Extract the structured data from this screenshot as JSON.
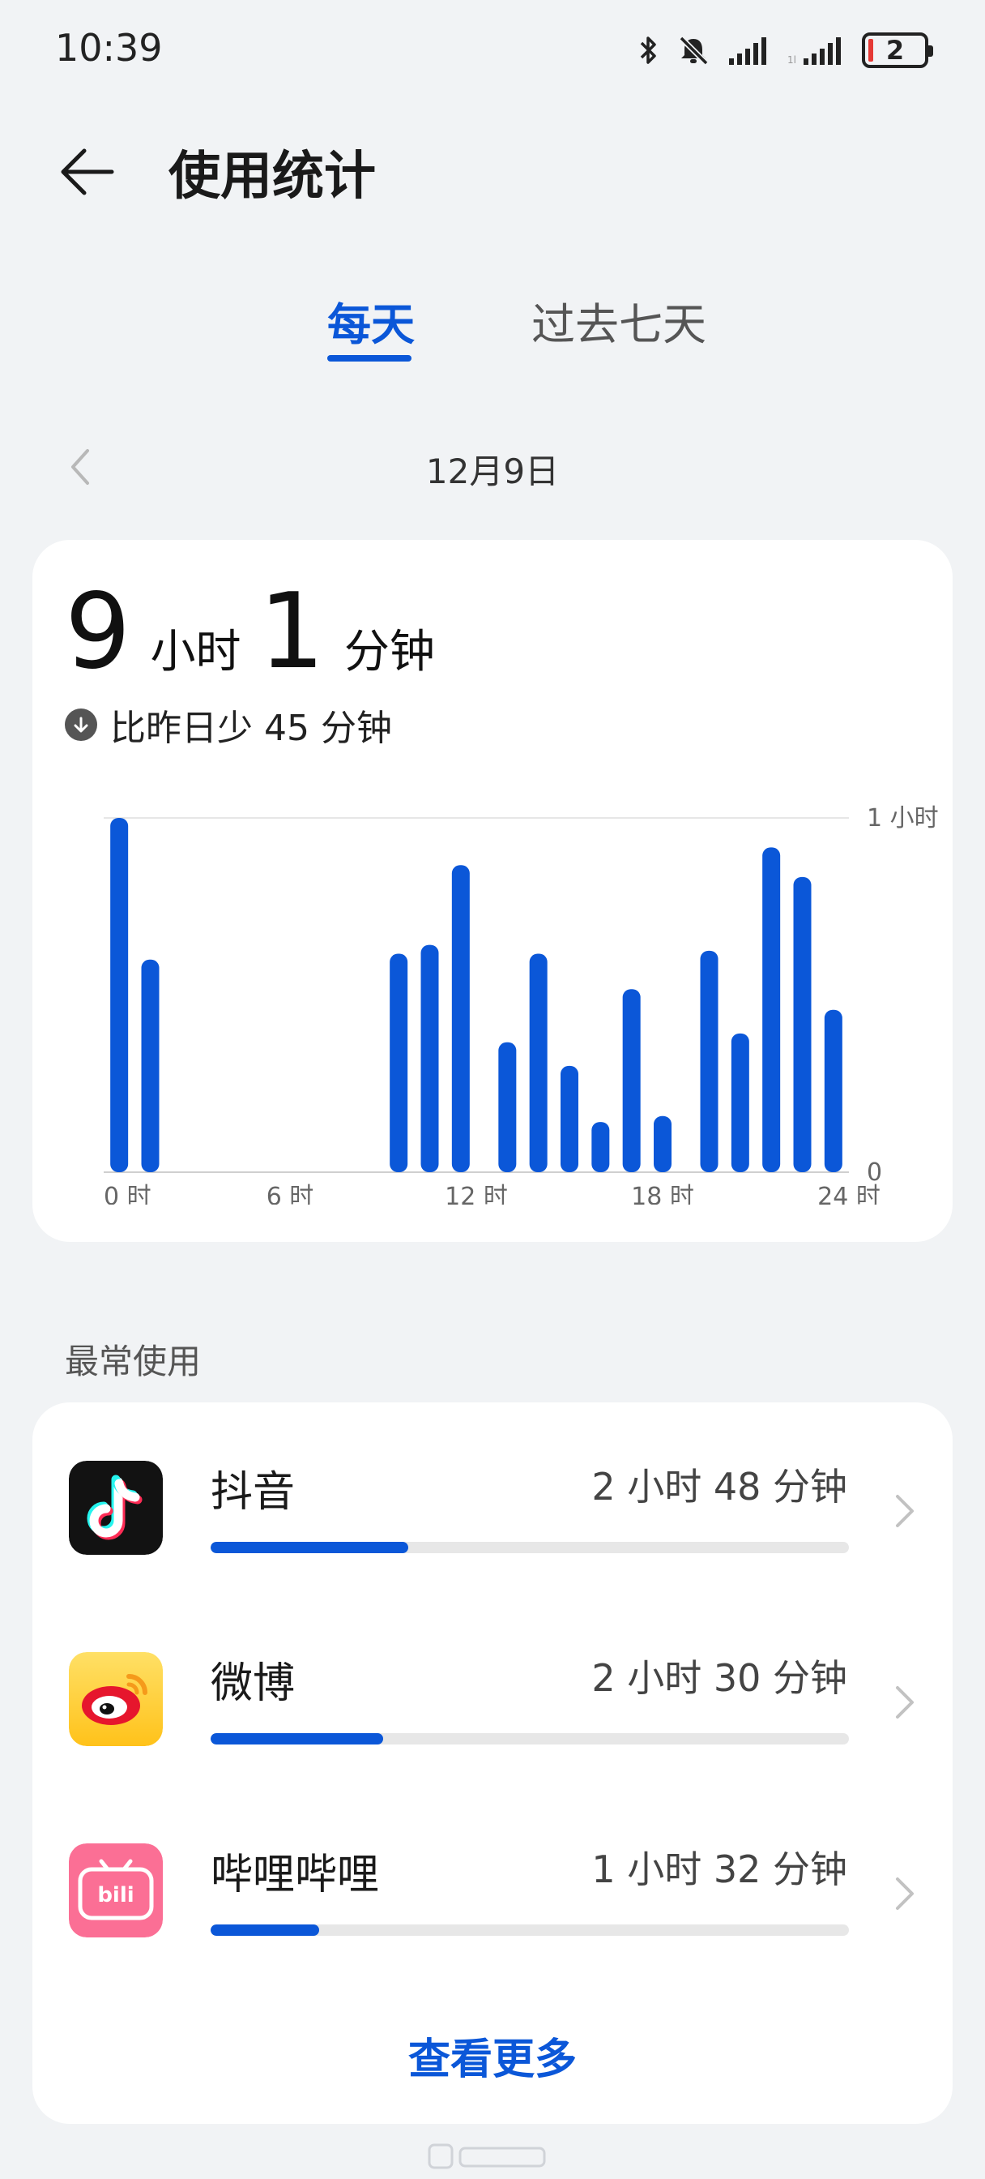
{
  "status_bar": {
    "time": "10:39",
    "battery_level": "2",
    "icons": [
      "bluetooth-icon",
      "mute-icon",
      "signal-icon",
      "signal-icon-2"
    ]
  },
  "header": {
    "title": "使用统计",
    "back_icon": "back-arrow-icon"
  },
  "tabs": [
    {
      "label": "每天",
      "active": true
    },
    {
      "label": "过去七天",
      "active": false
    }
  ],
  "date": {
    "label": "12月9日"
  },
  "summary": {
    "hours": "9",
    "hours_unit": "小时",
    "minutes": "1",
    "minutes_unit": "分钟",
    "compare_text": "比昨日少 45 分钟"
  },
  "chart_data": {
    "type": "bar",
    "x_ticks": [
      "0 时",
      "6 时",
      "12 时",
      "18 时",
      "24 时"
    ],
    "y_ticks": [
      "1 小时",
      "0"
    ],
    "ylim": [
      0,
      60
    ],
    "ylabel_unit": "分钟",
    "bars": [
      {
        "hour": 0.5,
        "value": 60
      },
      {
        "hour": 1.5,
        "value": 36
      },
      {
        "hour": 9.5,
        "value": 37
      },
      {
        "hour": 10.5,
        "value": 38.5
      },
      {
        "hour": 11.5,
        "value": 52
      },
      {
        "hour": 13,
        "value": 22
      },
      {
        "hour": 14,
        "value": 37
      },
      {
        "hour": 15,
        "value": 18
      },
      {
        "hour": 16,
        "value": 8.5
      },
      {
        "hour": 17,
        "value": 31
      },
      {
        "hour": 18,
        "value": 9.5
      },
      {
        "hour": 19.5,
        "value": 37.5
      },
      {
        "hour": 20.5,
        "value": 23.5
      },
      {
        "hour": 21.5,
        "value": 55
      },
      {
        "hour": 22.5,
        "value": 50
      },
      {
        "hour": 23.5,
        "value": 27.5
      }
    ],
    "color": "#0b57d8",
    "grid": "top-line-only"
  },
  "most_used": {
    "label": "最常使用",
    "apps": [
      {
        "name": "抖音",
        "time": "2 小时 48 分钟",
        "share": 0.31,
        "icon": "douyin-icon"
      },
      {
        "name": "微博",
        "time": "2 小时 30 分钟",
        "share": 0.27,
        "icon": "weibo-icon"
      },
      {
        "name": "哔哩哔哩",
        "time": "1 小时 32 分钟",
        "share": 0.17,
        "icon": "bilibili-icon"
      }
    ],
    "see_more": "查看更多"
  },
  "colors": {
    "accent": "#0b57d8",
    "background": "#f1f3f5",
    "card": "#ffffff"
  }
}
